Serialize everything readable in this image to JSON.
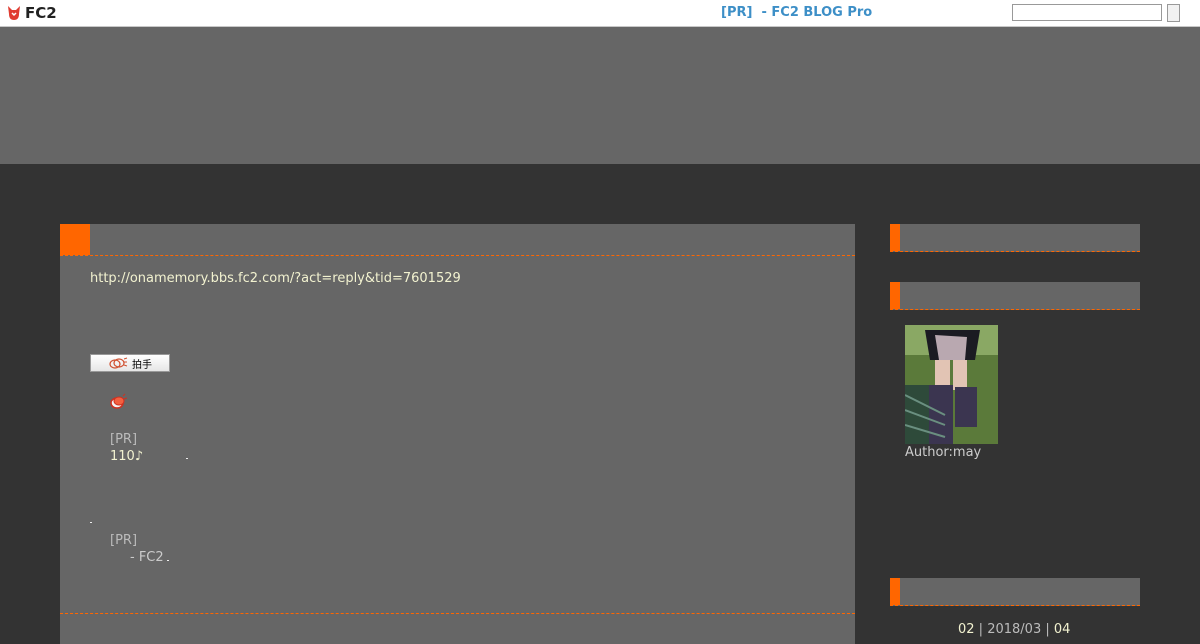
{
  "topbar": {
    "logo_text": "FC2",
    "pr_text": "[PR]  - FC2 BLOG Pro",
    "search": {
      "value": "",
      "placeholder": ""
    }
  },
  "entry": {
    "link": "http://onamemory.bbs.fc2.com/?act=reply&tid=7601529",
    "clap_label": "拍手",
    "pr1_label": "[PR]",
    "pr1_text": "110♪",
    "pr2_label": "[PR]",
    "pr2_text": "- FC2"
  },
  "sidebar": {
    "author": "Author:may",
    "calendar": {
      "prev": "02",
      "current": "2018/03",
      "next": "04"
    }
  },
  "colors": {
    "accent": "#ff6600",
    "panel": "#666666",
    "background": "#333333",
    "link": "#f2f2d0",
    "topbar_pr": "#3d8fc7"
  }
}
